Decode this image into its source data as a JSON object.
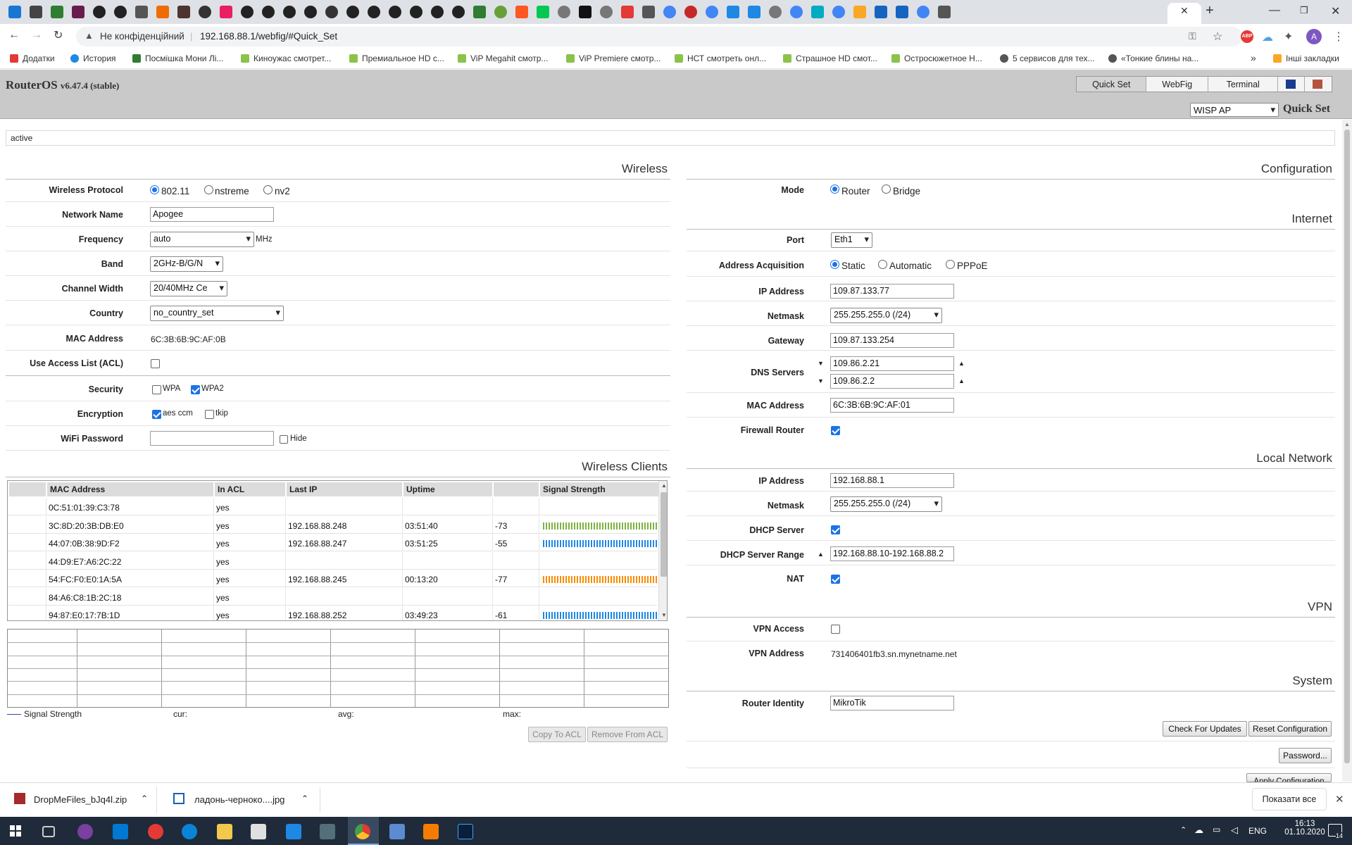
{
  "browser": {
    "address_security": "Не конфіденційний",
    "url": "192.168.88.1/webfig/#Quick_Set",
    "profile_initial": "A",
    "bookmarks": [
      "Додатки",
      "История",
      "Посмішка Мони Лі...",
      "Киноужас смотрет...",
      "Премиальное HD с...",
      "ViP Megahit смотр...",
      "ViP Premiere смотр...",
      "НСТ смотреть онл...",
      "Страшное HD смот...",
      "Остросюжетное Н...",
      "5 сервисов для тех...",
      "«Тонкие блины на..."
    ],
    "bookmarks_more": "»",
    "other_bookmarks": "Інші закладки"
  },
  "router": {
    "brand": "RouterOS",
    "version": "v6.47.4 (stable)",
    "nav": {
      "quickset": "Quick Set",
      "webfig": "WebFig",
      "terminal": "Terminal"
    },
    "mode_select": "WISP AP",
    "page_title": "Quick Set",
    "status": "active"
  },
  "wireless": {
    "title": "Wireless",
    "protocol_label": "Wireless Protocol",
    "protocols": [
      "802.11",
      "nstreme",
      "nv2"
    ],
    "network_name_label": "Network Name",
    "network_name": "Apogee",
    "frequency_label": "Frequency",
    "frequency": "auto",
    "frequency_unit": "MHz",
    "band_label": "Band",
    "band": "2GHz-B/G/N",
    "channel_width_label": "Channel Width",
    "channel_width": "20/40MHz Ce",
    "country_label": "Country",
    "country": "no_country_set",
    "mac_label": "MAC Address",
    "mac": "6C:3B:6B:9C:AF:0B",
    "acl_label": "Use Access List (ACL)",
    "security_label": "Security",
    "sec_wpa": "WPA",
    "sec_wpa2": "WPA2",
    "encryption_label": "Encryption",
    "enc_aes": "aes ccm",
    "enc_tkip": "tkip",
    "password_label": "WiFi Password",
    "password": "",
    "hide_label": "Hide"
  },
  "clients": {
    "title": "Wireless Clients",
    "headers": [
      "MAC Address",
      "In ACL",
      "Last IP",
      "Uptime",
      "",
      "Signal Strength"
    ],
    "rows": [
      {
        "mac": "0C:51:01:39:C3:78",
        "acl": "yes",
        "ip": "",
        "uptime": "",
        "signal": "",
        "bar": "none"
      },
      {
        "mac": "3C:8D:20:3B:DB:E0",
        "acl": "yes",
        "ip": "192.168.88.248",
        "uptime": "03:51:40",
        "signal": "-73",
        "bar": "green"
      },
      {
        "mac": "44:07:0B:38:9D:F2",
        "acl": "yes",
        "ip": "192.168.88.247",
        "uptime": "03:51:25",
        "signal": "-55",
        "bar": "blue"
      },
      {
        "mac": "44:D9:E7:A6:2C:22",
        "acl": "yes",
        "ip": "",
        "uptime": "",
        "signal": "",
        "bar": "none"
      },
      {
        "mac": "54:FC:F0:E0:1A:5A",
        "acl": "yes",
        "ip": "192.168.88.245",
        "uptime": "00:13:20",
        "signal": "-77",
        "bar": "orange"
      },
      {
        "mac": "84:A6:C8:1B:2C:18",
        "acl": "yes",
        "ip": "",
        "uptime": "",
        "signal": "",
        "bar": "none"
      },
      {
        "mac": "94:87:E0:17:7B:1D",
        "acl": "yes",
        "ip": "192.168.88.252",
        "uptime": "03:49:23",
        "signal": "-61",
        "bar": "blue"
      }
    ],
    "legend": "Signal Strength",
    "cur": "cur:",
    "avg": "avg:",
    "max": "max:",
    "copy_btn": "Copy To ACL",
    "remove_btn": "Remove From ACL",
    "colors": {
      "green": "#7cb342",
      "blue": "#1e88e5",
      "orange": "#fb8c00"
    }
  },
  "configuration": {
    "title": "Configuration",
    "mode_label": "Mode",
    "mode_router": "Router",
    "mode_bridge": "Bridge"
  },
  "internet": {
    "title": "Internet",
    "port_label": "Port",
    "port": "Eth1",
    "acq_label": "Address Acquisition",
    "acq_static": "Static",
    "acq_auto": "Automatic",
    "acq_pppoe": "PPPoE",
    "ip_label": "IP Address",
    "ip": "109.87.133.77",
    "netmask_label": "Netmask",
    "netmask": "255.255.255.0 (/24)",
    "gateway_label": "Gateway",
    "gateway": "109.87.133.254",
    "dns_label": "DNS Servers",
    "dns1": "109.86.2.21",
    "dns2": "109.86.2.2",
    "mac_label": "MAC Address",
    "mac": "6C:3B:6B:9C:AF:01",
    "firewall_label": "Firewall Router"
  },
  "local": {
    "title": "Local Network",
    "ip_label": "IP Address",
    "ip": "192.168.88.1",
    "netmask_label": "Netmask",
    "netmask": "255.255.255.0 (/24)",
    "dhcp_label": "DHCP Server",
    "range_label": "DHCP Server Range",
    "range": "192.168.88.10-192.168.88.2",
    "nat_label": "NAT"
  },
  "vpn": {
    "title": "VPN",
    "access_label": "VPN Access",
    "address_label": "VPN Address",
    "address": "731406401fb3.sn.mynetname.net"
  },
  "system": {
    "title": "System",
    "identity_label": "Router Identity",
    "identity": "MikroTik",
    "check_btn": "Check For Updates",
    "reset_btn": "Reset Configuration",
    "password_btn": "Password...",
    "apply_btn": "Apply Configuration"
  },
  "downloads": {
    "file1": "DropMeFiles_bJq4l.zip",
    "file2": "ладонь-черноко....jpg",
    "show_all": "Показати все"
  },
  "taskbar": {
    "lang": "ENG",
    "time": "16:13",
    "date": "01.10.2020",
    "notif": "14"
  }
}
